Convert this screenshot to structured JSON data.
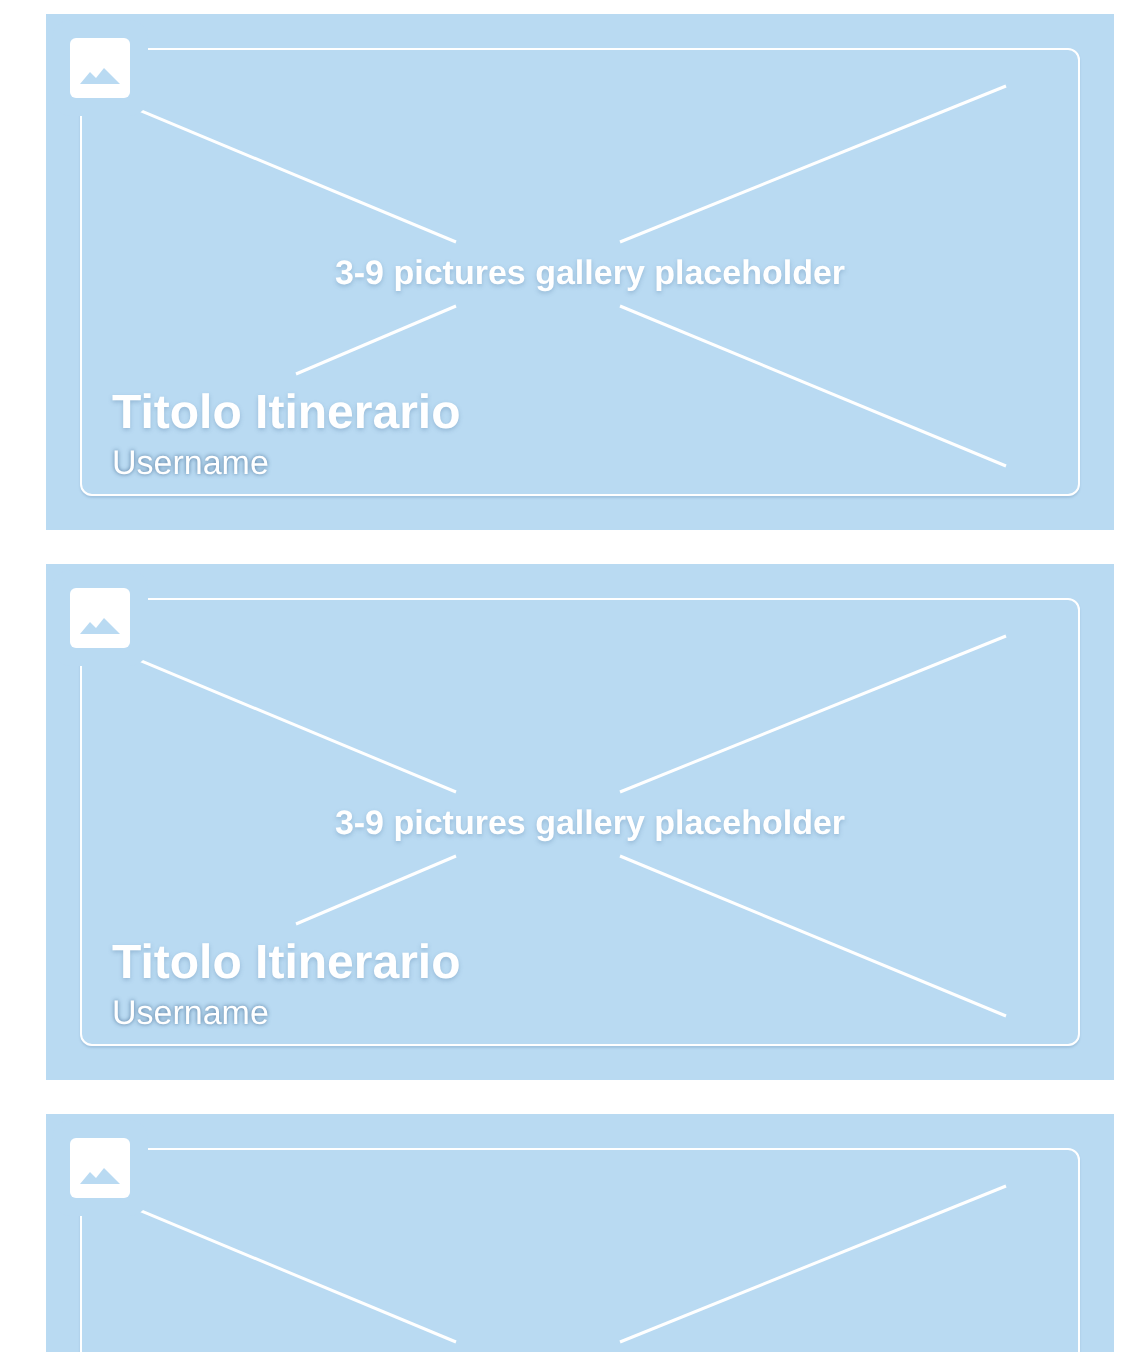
{
  "cards": [
    {
      "kind": "gallery",
      "placeholder": "3-9 pictures gallery placeholder",
      "title": "Titolo Itinerario",
      "username": "Username"
    },
    {
      "kind": "gallery",
      "placeholder": "3-9 pictures gallery placeholder",
      "title": "Titolo Itinerario",
      "username": "Username"
    },
    {
      "kind": "gallery"
    }
  ]
}
